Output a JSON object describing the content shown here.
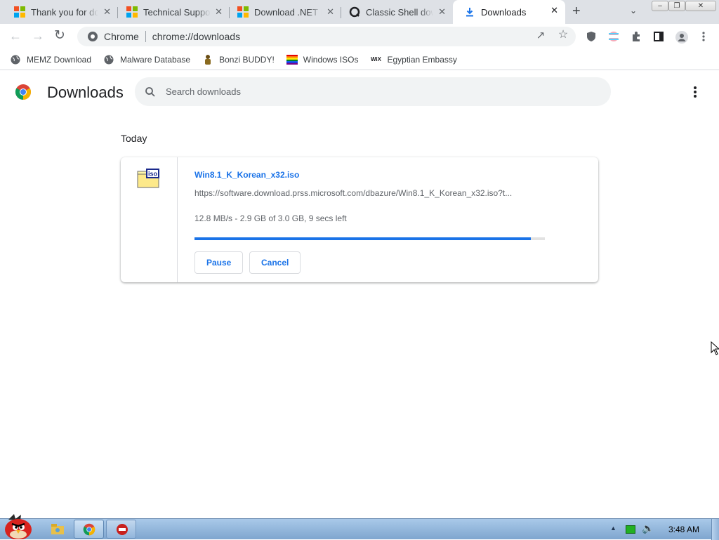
{
  "tabs": [
    {
      "title": "Thank you for downloading",
      "icon": "microsoft-logo-icon",
      "active": false
    },
    {
      "title": "Technical Support",
      "icon": "microsoft-logo-icon",
      "active": false
    },
    {
      "title": "Download .NET Framework",
      "icon": "microsoft-logo-icon",
      "active": false
    },
    {
      "title": "Classic Shell download",
      "icon": "classic-shell-icon",
      "active": false
    },
    {
      "title": "Downloads",
      "icon": "download-icon",
      "active": true
    }
  ],
  "tab_close_glyph": "✕",
  "new_tab_glyph": "+",
  "omnibox": {
    "site_label": "Chrome",
    "url": "chrome://downloads"
  },
  "bookmarks": [
    {
      "label": "MEMZ Download",
      "icon": "globe-icon"
    },
    {
      "label": "Malware Database",
      "icon": "globe-icon"
    },
    {
      "label": "Bonzi BUDDY!",
      "icon": "bonzi-icon"
    },
    {
      "label": "Windows ISOs",
      "icon": "rainbow-flag-icon"
    },
    {
      "label": "Egyptian Embassy",
      "icon": "wix-icon"
    }
  ],
  "page": {
    "title": "Downloads",
    "search_placeholder": "Search downloads",
    "date_heading": "Today"
  },
  "download": {
    "file_name": "Win8.1_K_Korean_x32.iso",
    "url": "https://software.download.prss.microsoft.com/dbazure/Win8.1_K_Korean_x32.iso?t...",
    "status": "12.8 MB/s - 2.9 GB of 3.0 GB, 9 secs left",
    "progress_percent": 96,
    "file_icon_label": "iso",
    "pause_label": "Pause",
    "cancel_label": "Cancel"
  },
  "taskbar": {
    "clock": "3:48 AM"
  },
  "colors": {
    "accent": "#1a73e8",
    "tabstrip": "#dee1e6",
    "taskbar": "#8fb3da"
  }
}
